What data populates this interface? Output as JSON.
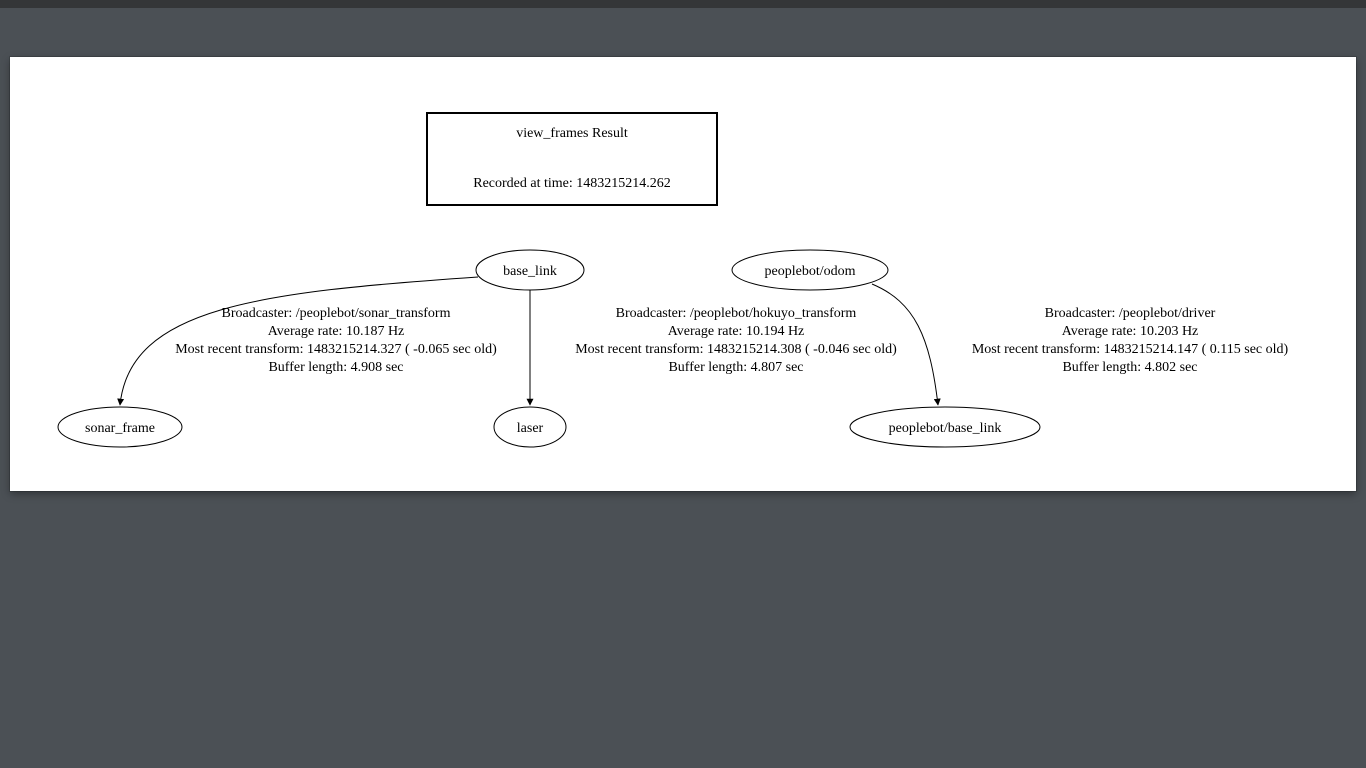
{
  "header": {
    "title": "view_frames Result",
    "recorded_label": "Recorded at time: 1483215214.262"
  },
  "nodes": {
    "base_link": "base_link",
    "peoplebot_odom": "peoplebot/odom",
    "sonar_frame": "sonar_frame",
    "laser": "laser",
    "peoplebot_base_link": "peoplebot/base_link"
  },
  "edges": {
    "sonar": {
      "broadcaster": "Broadcaster: /peoplebot/sonar_transform",
      "rate": "Average rate: 10.187 Hz",
      "recent": "Most recent transform: 1483215214.327 ( -0.065 sec old)",
      "buffer": "Buffer length: 4.908 sec"
    },
    "laser": {
      "broadcaster": "Broadcaster: /peoplebot/hokuyo_transform",
      "rate": "Average rate: 10.194 Hz",
      "recent": "Most recent transform: 1483215214.308 ( -0.046 sec old)",
      "buffer": "Buffer length: 4.807 sec"
    },
    "driver": {
      "broadcaster": "Broadcaster: /peoplebot/driver",
      "rate": "Average rate: 10.203 Hz",
      "recent": "Most recent transform: 1483215214.147 ( 0.115 sec old)",
      "buffer": "Buffer length: 4.802 sec"
    }
  }
}
